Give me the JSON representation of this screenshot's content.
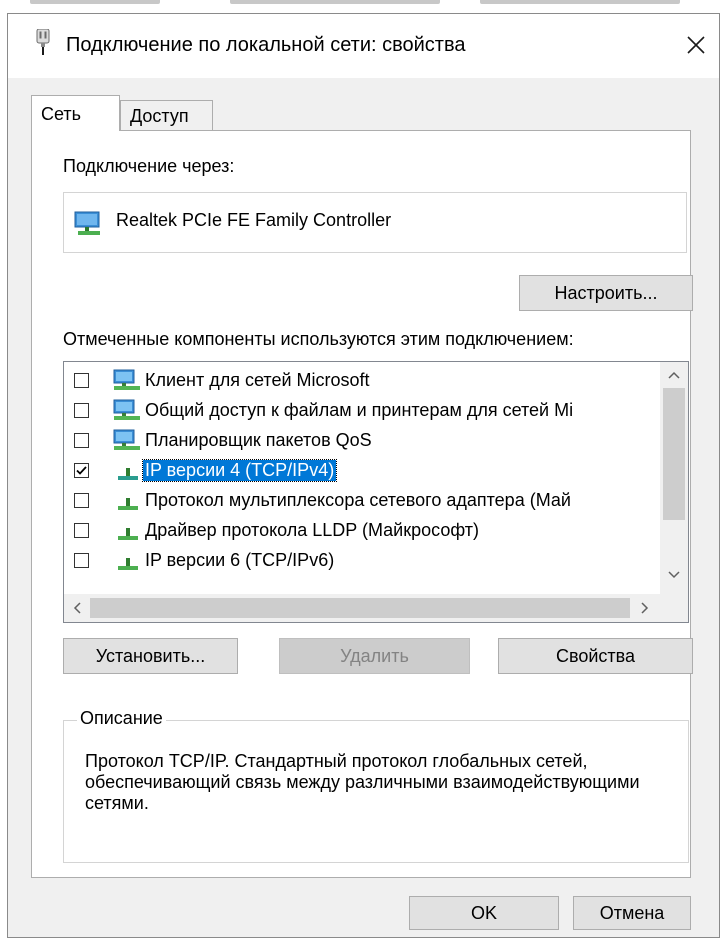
{
  "window": {
    "title": "Подключение по локальной сети: свойства"
  },
  "tabs": [
    {
      "label": "Сеть",
      "active": true
    },
    {
      "label": "Доступ",
      "active": false
    }
  ],
  "connect_using": {
    "label": "Подключение через:",
    "adapter": "Realtek PCIe FE Family Controller"
  },
  "configure_button": "Настроить...",
  "components": {
    "label": "Отмеченные компоненты используются этим подключением:",
    "items": [
      {
        "label": "Клиент для сетей Microsoft",
        "checked": false,
        "icon": "network-client-icon",
        "selected": false
      },
      {
        "label": "Общий доступ к файлам и принтерам для сетей Mi",
        "checked": false,
        "icon": "network-service-icon",
        "selected": false
      },
      {
        "label": "Планировщик пакетов QoS",
        "checked": false,
        "icon": "network-service-icon",
        "selected": false
      },
      {
        "label": "IP версии 4 (TCP/IPv4)",
        "checked": true,
        "icon": "protocol-icon",
        "selected": true
      },
      {
        "label": "Протокол мультиплексора сетевого адаптера (Май",
        "checked": false,
        "icon": "protocol-icon",
        "selected": false
      },
      {
        "label": "Драйвер протокола LLDP (Майкрософт)",
        "checked": false,
        "icon": "protocol-icon",
        "selected": false
      },
      {
        "label": "IP версии 6 (TCP/IPv6)",
        "checked": false,
        "icon": "protocol-icon",
        "selected": false
      }
    ]
  },
  "actions": {
    "install": "Установить...",
    "uninstall": "Удалить",
    "properties": "Свойства"
  },
  "description": {
    "legend": "Описание",
    "text": "Протокол TCP/IP. Стандартный протокол глобальных сетей, обеспечивающий связь между различными взаимодействующими сетями."
  },
  "footer": {
    "ok": "OK",
    "cancel": "Отмена"
  },
  "colors": {
    "accent": "#0078d7",
    "dialog_bg": "#f0f0f0",
    "selection": "#0078d7"
  }
}
